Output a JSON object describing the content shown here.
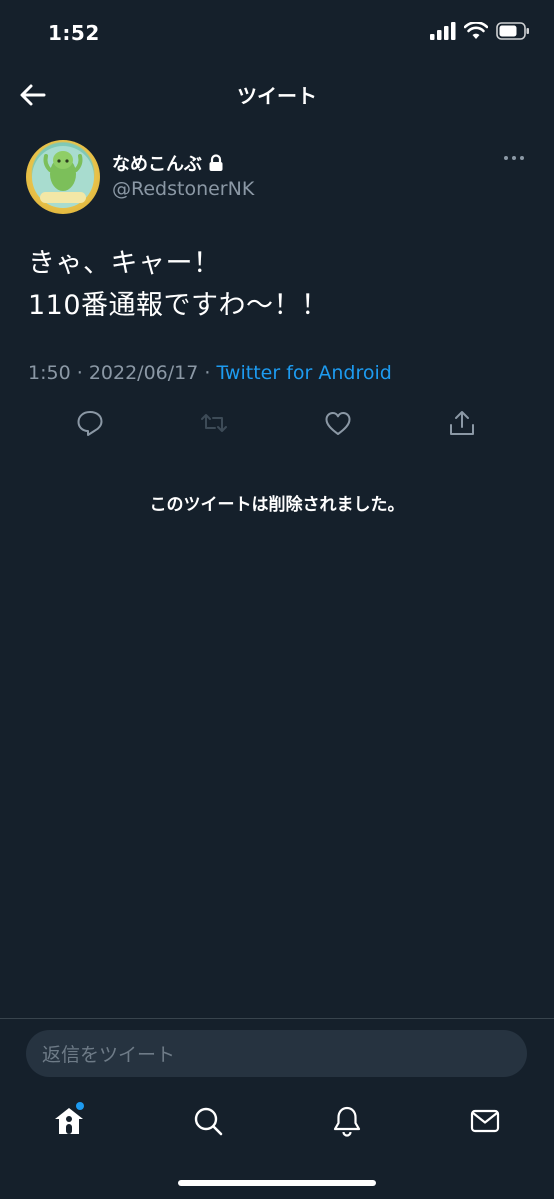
{
  "status_bar": {
    "time": "1:52"
  },
  "header": {
    "title": "ツイート"
  },
  "author": {
    "display_name": "なめこんぶ",
    "handle": "@RedstonerNK",
    "avatar_caption": "なめこんぶ"
  },
  "tweet": {
    "lines": [
      "きゃ、キャー！",
      "110番通報ですわ〜！！"
    ],
    "time": "1:50",
    "date": "2022/06/17",
    "separator": "·",
    "client": "Twitter for Android"
  },
  "deleted_notice": "このツイートは削除されました。",
  "reply": {
    "placeholder": "返信をツイート"
  },
  "colors": {
    "background": "#15202b",
    "accent": "#1d9bf0",
    "muted": "#8b98a5"
  },
  "icons": {
    "actions": [
      "reply-icon",
      "retweet-icon",
      "like-icon",
      "share-icon"
    ],
    "tabs": [
      "home-icon",
      "search-icon",
      "notifications-icon",
      "messages-icon"
    ]
  }
}
